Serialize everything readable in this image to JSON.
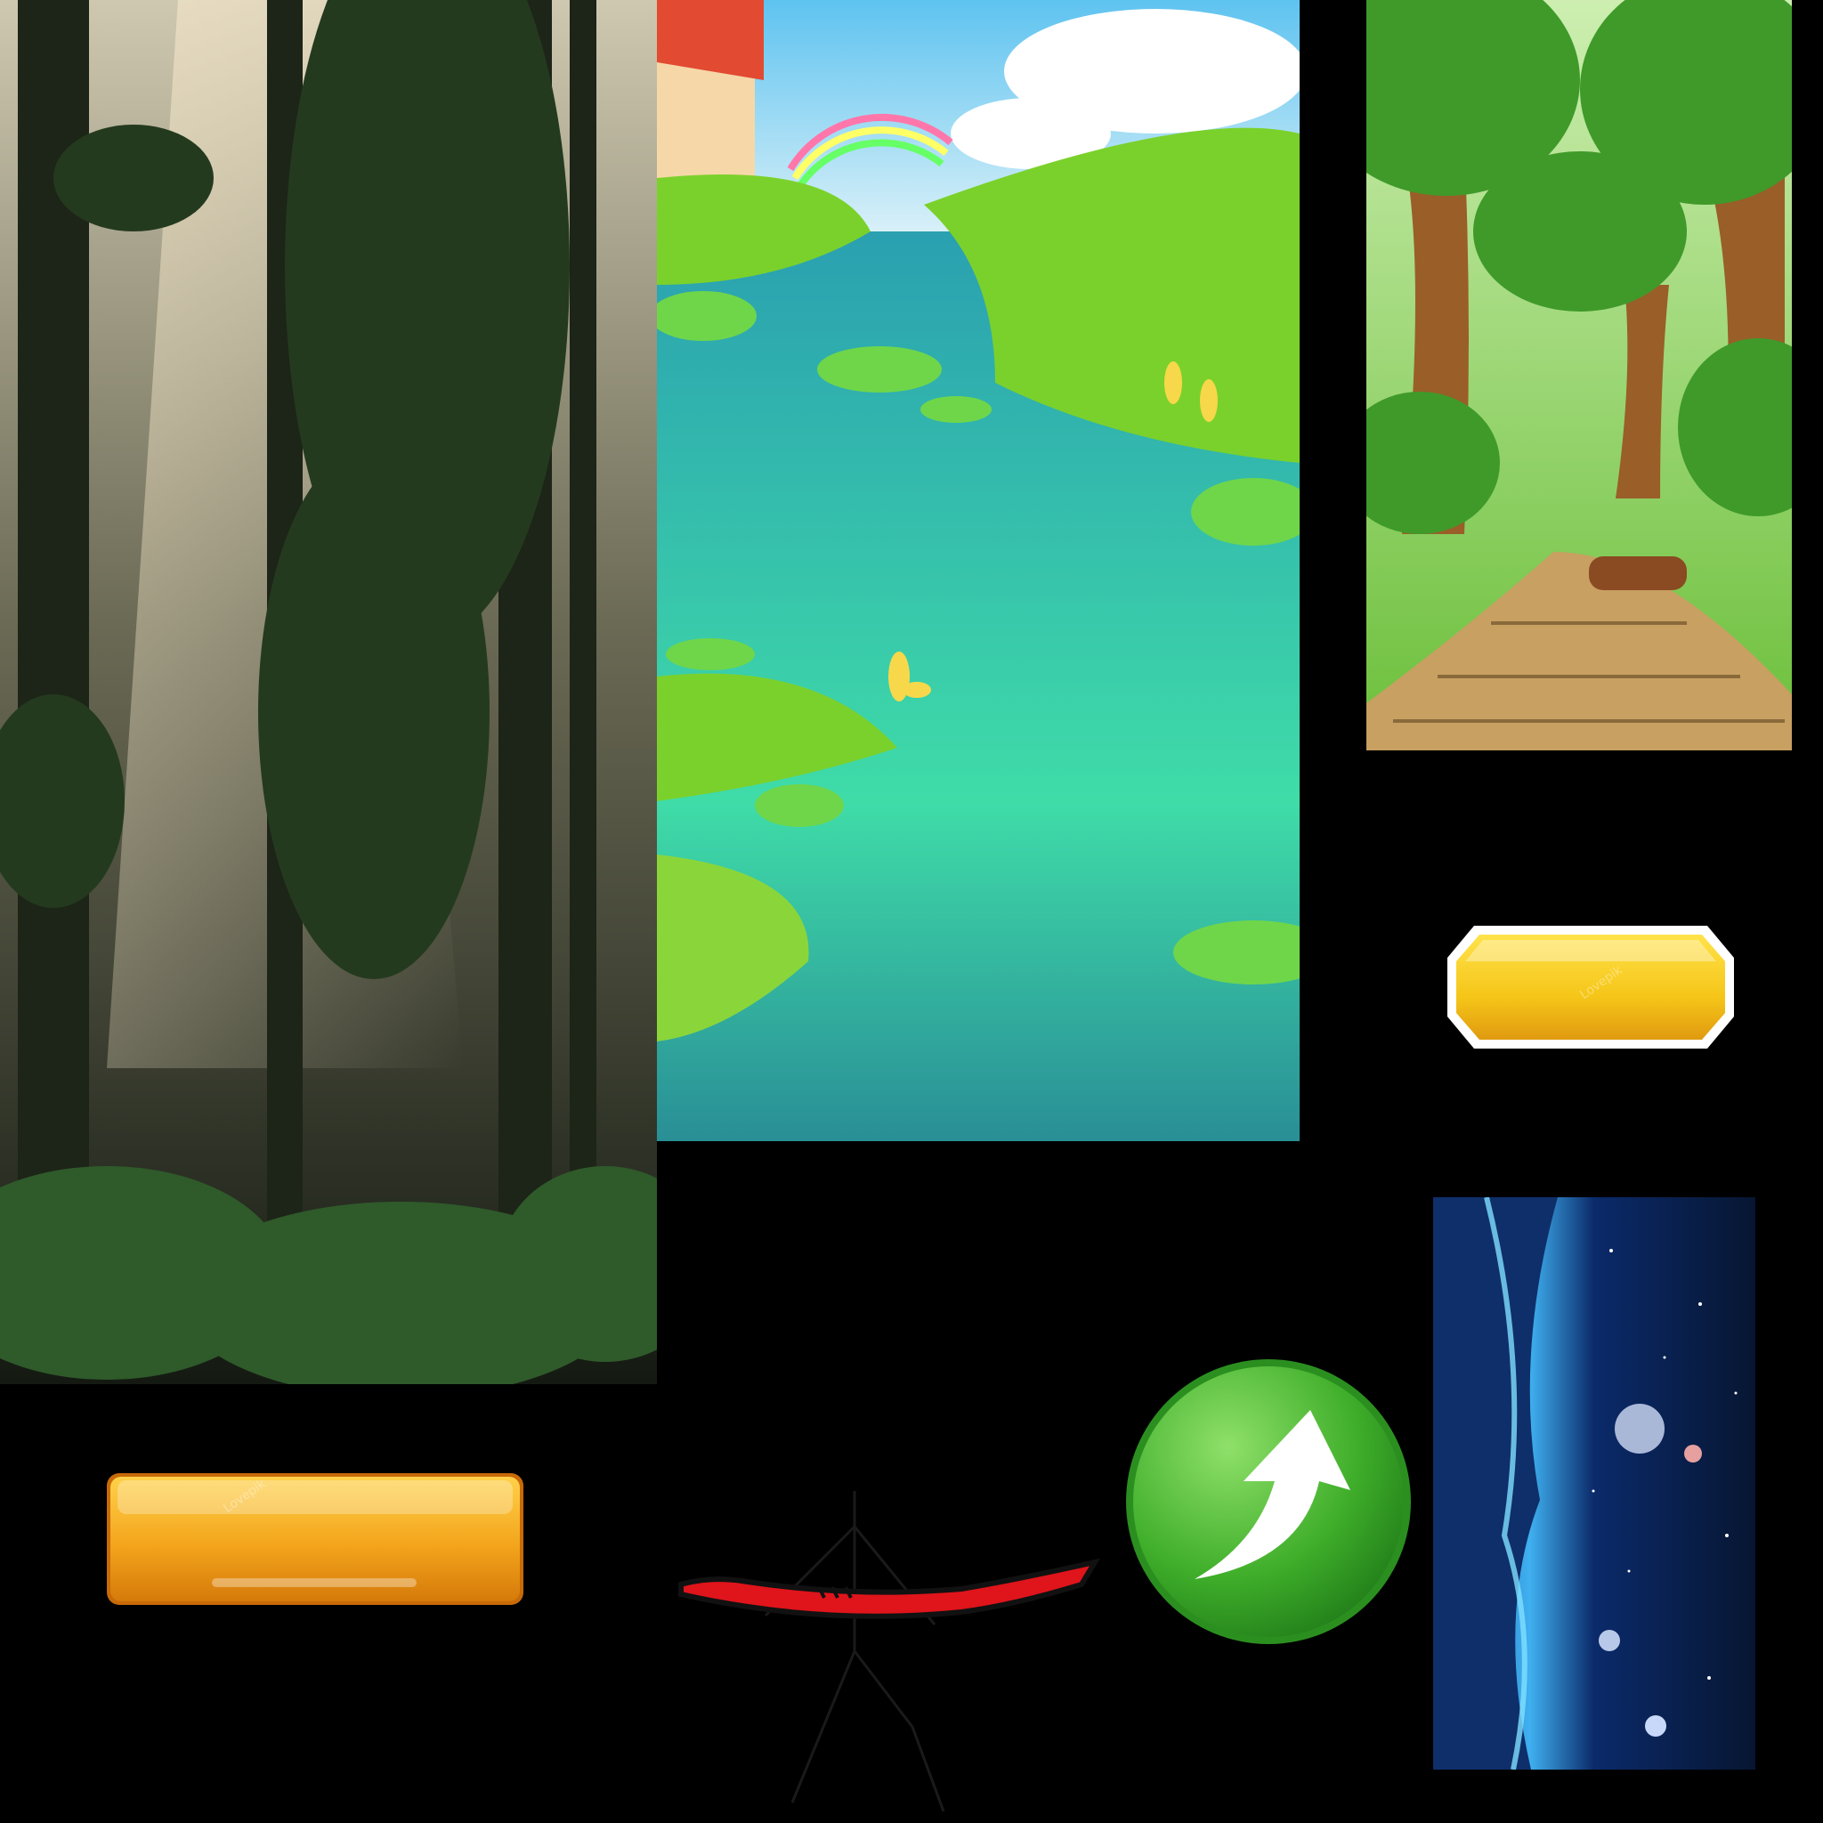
{
  "assets": [
    {
      "name": "misty-forest-background",
      "kind": "photo-background"
    },
    {
      "name": "cartoon-pond-background",
      "kind": "illustrated-background"
    },
    {
      "name": "forest-path-background",
      "kind": "illustrated-background"
    },
    {
      "name": "yellow-hexagon-button",
      "kind": "button-sprite"
    },
    {
      "name": "orange-rectangle-button",
      "kind": "button-sprite"
    },
    {
      "name": "stickman-sword-fighter",
      "kind": "character-sprite"
    },
    {
      "name": "green-arrow-up-button",
      "kind": "button-sprite"
    },
    {
      "name": "space-cave-background",
      "kind": "illustrated-background"
    }
  ],
  "watermarks": {
    "hex_button": "Lovepik",
    "rect_button": "Lovepik"
  },
  "colors": {
    "background": "#000000",
    "yellow_button": "#f5c518",
    "orange_button": "#f3a51c",
    "green_button": "#3fae2a",
    "sword_red": "#e0141b",
    "water": "#3cc3a0",
    "grass": "#7bd12b",
    "forest_dark": "#1f2a1a",
    "space_blue": "#0b1f4a"
  }
}
